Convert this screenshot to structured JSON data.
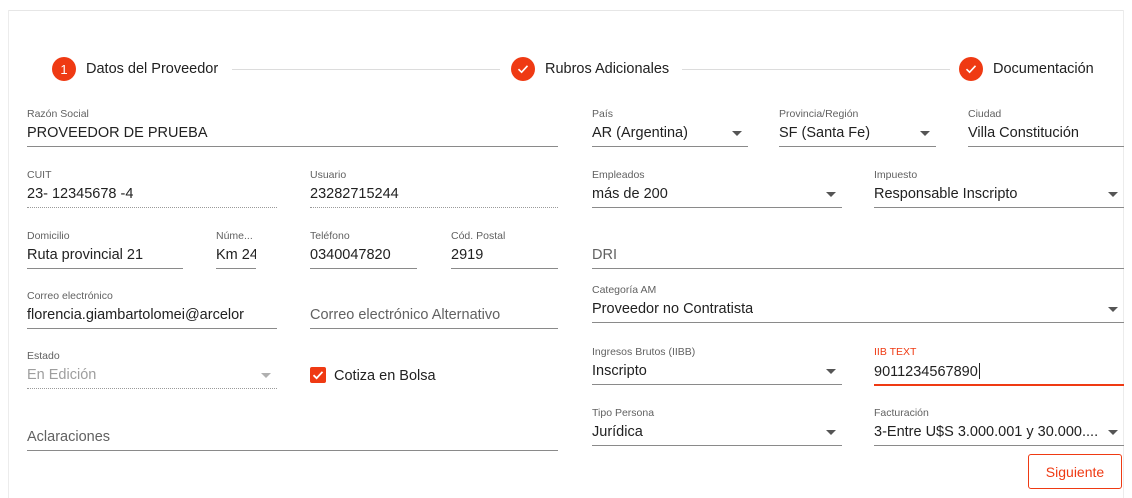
{
  "stepper": {
    "steps": [
      {
        "number": "1",
        "label": "Datos del Proveedor"
      },
      {
        "label": "Rubros Adicionales"
      },
      {
        "label": "Documentación"
      }
    ]
  },
  "form": {
    "razon_social": {
      "label": "Razón Social",
      "value": "PROVEEDOR DE PRUEBA"
    },
    "cuit": {
      "label": "CUIT",
      "value": "23- 12345678 -4"
    },
    "usuario": {
      "label": "Usuario",
      "value": "23282715244"
    },
    "domicilio": {
      "label": "Domicilio",
      "value": "Ruta provincial 21"
    },
    "numero": {
      "label": "Núme...",
      "value": "Km 24"
    },
    "telefono": {
      "label": "Teléfono",
      "value": "0340047820"
    },
    "cod_postal": {
      "label": "Cód. Postal",
      "value": "2919"
    },
    "correo": {
      "label": "Correo electrónico",
      "value": "florencia.giambartolomei@arcelor"
    },
    "correo_alt": {
      "placeholder": "Correo electrónico Alternativo"
    },
    "estado": {
      "label": "Estado",
      "value": "En Edición"
    },
    "cotiza": {
      "label": "Cotiza en Bolsa",
      "checked": true
    },
    "aclaraciones": {
      "placeholder": "Aclaraciones"
    },
    "pais": {
      "label": "País",
      "value": "AR (Argentina)"
    },
    "provincia": {
      "label": "Provincia/Región",
      "value": "SF (Santa Fe)"
    },
    "ciudad": {
      "label": "Ciudad",
      "value": "Villa Constitución"
    },
    "empleados": {
      "label": "Empleados",
      "value": "más de 200"
    },
    "impuesto": {
      "label": "Impuesto",
      "value": "Responsable Inscripto"
    },
    "dri": {
      "placeholder": "DRI"
    },
    "categoria": {
      "label": "Categoría AM",
      "value": "Proveedor no Contratista"
    },
    "iibb": {
      "label": "Ingresos Brutos (IIBB)",
      "value": "Inscripto"
    },
    "iib_text": {
      "label": "IIB TEXT",
      "value": "9011234567890"
    },
    "tipo_persona": {
      "label": "Tipo Persona",
      "value": "Jurídica"
    },
    "facturacion": {
      "label": "Facturación",
      "value": "3-Entre U$S 3.000.001 y 30.000...."
    }
  },
  "buttons": {
    "next": "Siguiente"
  },
  "colors": {
    "accent": "#ef3a13"
  }
}
